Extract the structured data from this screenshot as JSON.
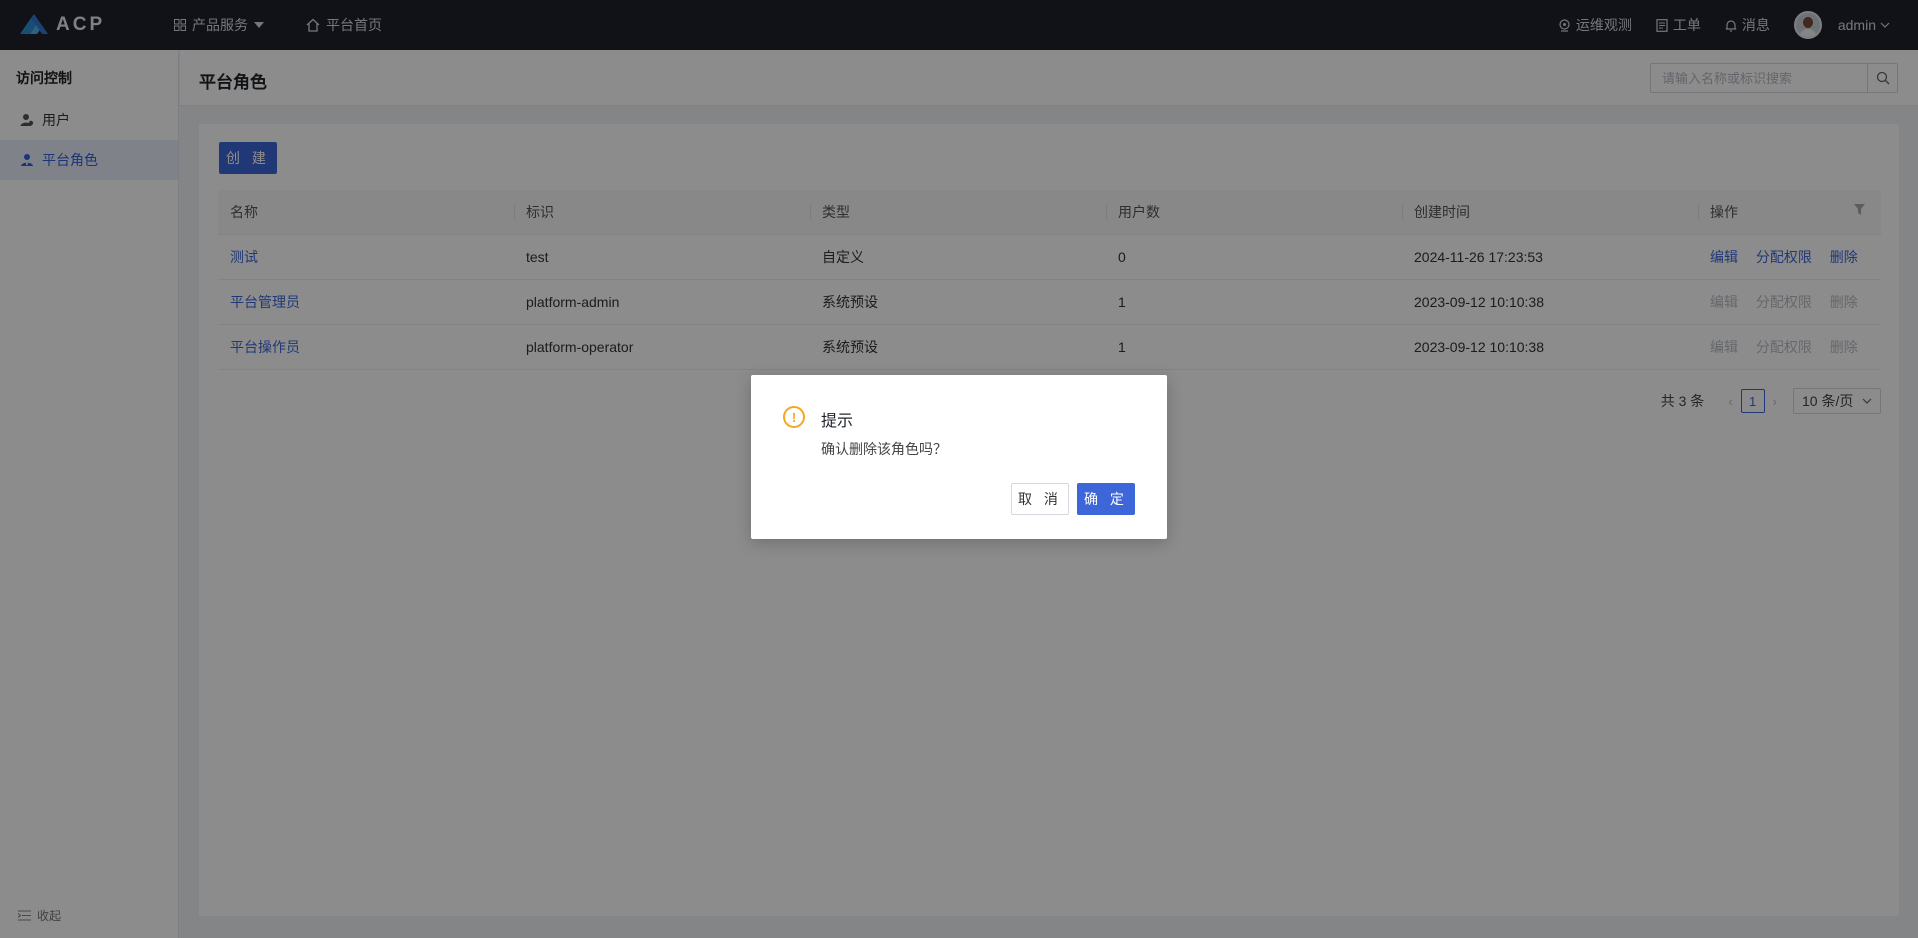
{
  "topbar": {
    "logo_text": "ACP",
    "nav": [
      {
        "label": "产品服务"
      },
      {
        "label": "平台首页"
      }
    ],
    "right": [
      {
        "label": "运维观测"
      },
      {
        "label": "工单"
      },
      {
        "label": "消息"
      }
    ],
    "user": "admin"
  },
  "sidebar": {
    "title": "访问控制",
    "items": [
      {
        "label": "用户"
      },
      {
        "label": "平台角色"
      }
    ],
    "collapse_label": "收起"
  },
  "page": {
    "title": "平台角色",
    "search_placeholder": "请输入名称或标识搜索",
    "create_label": "创 建"
  },
  "table": {
    "columns": [
      "名称",
      "标识",
      "类型",
      "用户数",
      "创建时间",
      "操作"
    ],
    "rows": [
      {
        "name": "测试",
        "id": "test",
        "type": "自定义",
        "users": "0",
        "created": "2024-11-26 17:23:53",
        "editable": true
      },
      {
        "name": "平台管理员",
        "id": "platform-admin",
        "type": "系统预设",
        "users": "1",
        "created": "2023-09-12 10:10:38",
        "editable": false
      },
      {
        "name": "平台操作员",
        "id": "platform-operator",
        "type": "系统预设",
        "users": "1",
        "created": "2023-09-12 10:10:38",
        "editable": false
      }
    ],
    "actions": {
      "edit": "编辑",
      "assign": "分配权限",
      "delete": "删除"
    }
  },
  "pagination": {
    "total": "共 3 条",
    "current_page": "1",
    "page_size": "10 条/页"
  },
  "modal": {
    "title": "提示",
    "content": "确认删除该角色吗？",
    "cancel": "取 消",
    "ok": "确 定",
    "warn_glyph": "!"
  },
  "colors": {
    "primary": "#3d66d9",
    "topbar": "#1e222d",
    "warning": "#f5a623"
  }
}
